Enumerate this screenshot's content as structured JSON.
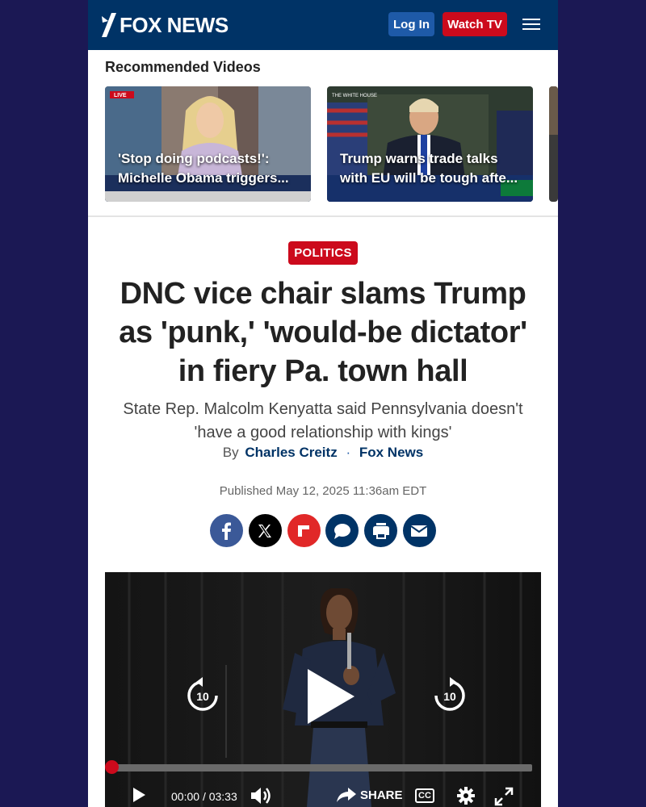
{
  "header": {
    "logo_text": "FOX NEWS",
    "login_label": "Log In",
    "watch_label": "Watch TV"
  },
  "recommended": {
    "title": "Recommended Videos",
    "items": [
      {
        "line1": "'Stop doing podcasts!':",
        "line2": "Michelle Obama triggers...",
        "badge": "LIVE"
      },
      {
        "line1": "Trump warns trade talks",
        "line2": "with EU will be tough afte...",
        "badge": "THE WHITE HOUSE"
      }
    ]
  },
  "article": {
    "tag": "POLITICS",
    "headline": "DNC vice chair slams Trump as 'punk,' 'would-be dictator' in fiery Pa. town hall",
    "subhead": "State Rep. Malcolm Kenyatta said Pennsylvania doesn't 'have a good relationship with kings'",
    "by": "By",
    "author": "Charles Creitz",
    "source": "Fox News",
    "published": "Published May 12, 2025 11:36am EDT"
  },
  "share_buttons": [
    {
      "name": "facebook-share-icon",
      "color": "#3b5998"
    },
    {
      "name": "x-share-icon",
      "color": "#000000"
    },
    {
      "name": "flipboard-share-icon",
      "color": "#e12828"
    },
    {
      "name": "comments-icon",
      "color": "#003366"
    },
    {
      "name": "print-icon",
      "color": "#003366"
    },
    {
      "name": "email-icon",
      "color": "#003366"
    }
  ],
  "video": {
    "rewind_label": "10",
    "forward_label": "10",
    "time_current": "00:00",
    "time_separator": "/",
    "time_total": "03:33",
    "share_label": "SHARE",
    "cc_label": "CC",
    "progress_fraction": 0.0
  },
  "colors": {
    "brand_navy": "#003366",
    "brand_red": "#cc0a1c",
    "login_blue": "#1e5aa8"
  }
}
